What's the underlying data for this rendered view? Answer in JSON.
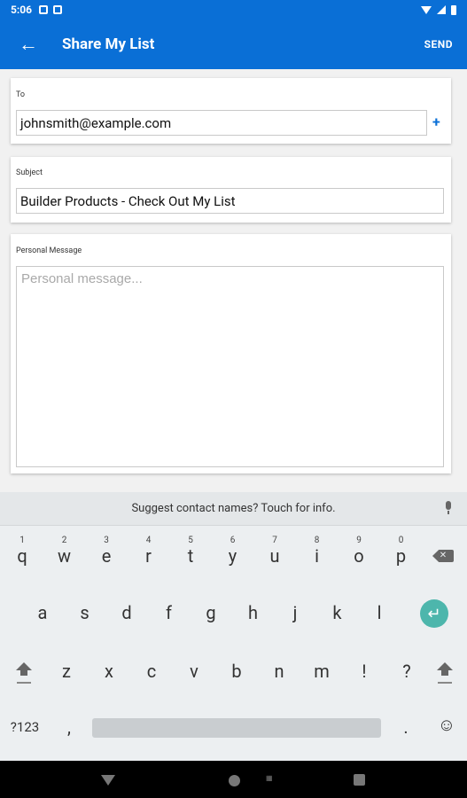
{
  "status": {
    "time": "5:06"
  },
  "appbar": {
    "title": "Share My List",
    "send": "SEND",
    "back_icon": "arrow-left-icon"
  },
  "to": {
    "label": "To",
    "value": "johnsmith@example.com",
    "add": "+"
  },
  "subject": {
    "label": "Subject",
    "value": "Builder Products - Check Out My List"
  },
  "message": {
    "label": "Personal Message",
    "placeholder": "Personal message..."
  },
  "suggest": {
    "text": "Suggest contact names? Touch for info."
  },
  "keyboard": {
    "row1": [
      "q",
      "w",
      "e",
      "r",
      "t",
      "y",
      "u",
      "i",
      "o",
      "p"
    ],
    "row1_hints": [
      "1",
      "2",
      "3",
      "4",
      "5",
      "6",
      "7",
      "8",
      "9",
      "0"
    ],
    "row2": [
      "a",
      "s",
      "d",
      "f",
      "g",
      "h",
      "j",
      "k",
      "l"
    ],
    "row3": [
      "z",
      "x",
      "c",
      "v",
      "b",
      "n",
      "m",
      "!",
      "?"
    ],
    "symbols": "?123",
    "comma": ",",
    "period": ".",
    "emoji": "☺",
    "enter": "↵"
  },
  "colors": {
    "primary": "#0a6fd6",
    "enter": "#4db6ac"
  }
}
